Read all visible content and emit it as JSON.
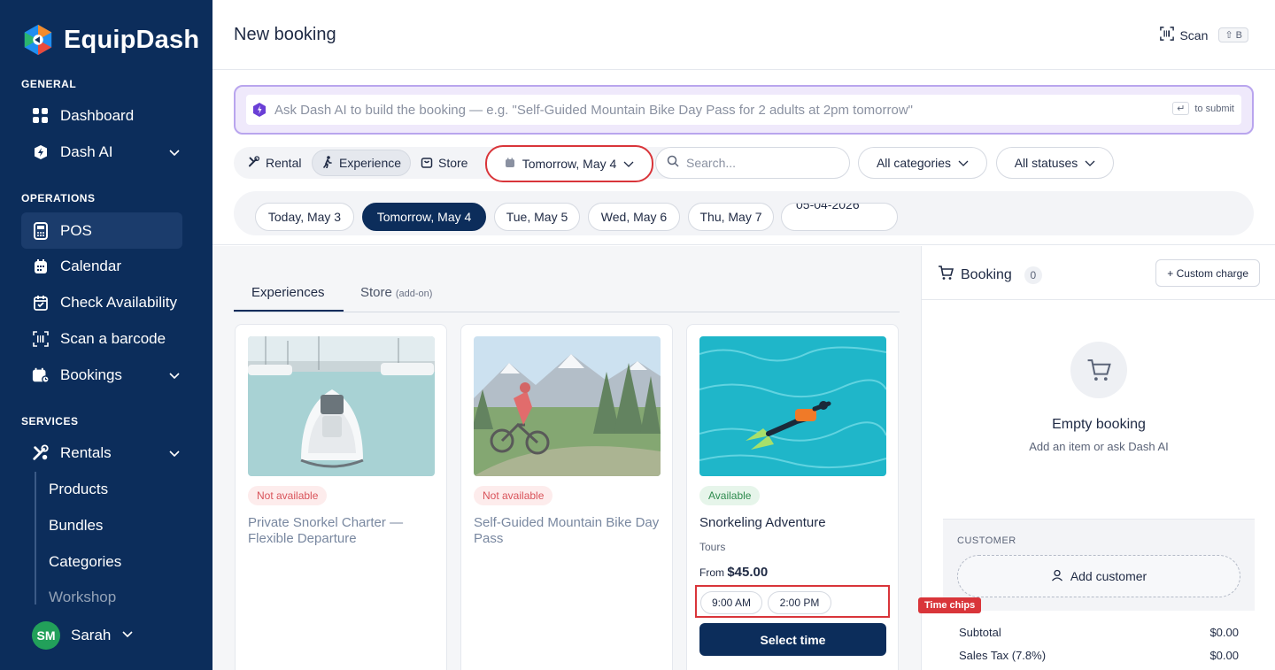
{
  "brand": {
    "name": "EquipDash"
  },
  "sidebar": {
    "sections": {
      "general": "GENERAL",
      "operations": "OPERATIONS",
      "services": "SERVICES"
    },
    "items": {
      "dashboard": "Dashboard",
      "dash_ai": "Dash AI",
      "pos": "POS",
      "calendar": "Calendar",
      "check_availability": "Check Availability",
      "scan_barcode": "Scan a barcode",
      "bookings": "Bookings",
      "rentals": "Rentals"
    },
    "rental_sub": [
      "Products",
      "Bundles",
      "Categories",
      "Workshop"
    ],
    "user": {
      "initials": "SM",
      "name": "Sarah"
    }
  },
  "header": {
    "title": "New booking",
    "scan_label": "Scan",
    "scan_shortcut": "⇧ B"
  },
  "ai": {
    "placeholder": "Ask Dash AI to build the booking — e.g. \"Self-Guided Mountain Bike Day Pass for 2 adults at 2pm tomorrow\"",
    "enter_key": "↵",
    "submit_hint": "to submit"
  },
  "modes": [
    "Rental",
    "Experience",
    "Store"
  ],
  "active_mode": "Experience",
  "date_select": {
    "value": "Tomorrow, May 4"
  },
  "search": {
    "placeholder": "Search..."
  },
  "filters": {
    "categories": "All categories",
    "statuses": "All statuses"
  },
  "date_chips": [
    "Today, May 3",
    "Tomorrow, May 4",
    "Tue, May 5",
    "Wed, May 6",
    "Thu, May 7"
  ],
  "active_date": "Tomorrow, May 4",
  "date_input": {
    "value": "05-04-2026"
  },
  "tabs": {
    "experiences": "Experiences",
    "store": "Store",
    "store_note": "(add-on)"
  },
  "cards": [
    {
      "status": "Not available",
      "title": "Private Snorkel Charter — Flexible Departure"
    },
    {
      "status": "Not available",
      "title": "Self-Guided Mountain Bike Day Pass"
    },
    {
      "status": "Available",
      "title": "Snorkeling Adventure",
      "category": "Tours",
      "price_prefix": "From",
      "price": "$45.00",
      "times": [
        "9:00 AM",
        "2:00 PM"
      ],
      "button": "Select time"
    }
  ],
  "annotation": {
    "label": "Time chips"
  },
  "booking": {
    "title": "Booking",
    "count": "0",
    "custom_charge": "+ Custom charge",
    "empty_title": "Empty booking",
    "empty_subtitle": "Add an item or ask Dash AI",
    "customer_label": "CUSTOMER",
    "add_customer": "Add customer",
    "subtotal_label": "Subtotal",
    "subtotal_value": "$0.00",
    "tax_label": "Sales Tax (7.8%)",
    "tax_value": "$0.00"
  },
  "colors": {
    "sidebar": "#0c2d5b",
    "primary": "#0c2d5b",
    "ai_accent": "#b9a5ee",
    "highlight": "#d9353a",
    "available": "#2e8b4e",
    "unavailable": "#d9535a"
  }
}
